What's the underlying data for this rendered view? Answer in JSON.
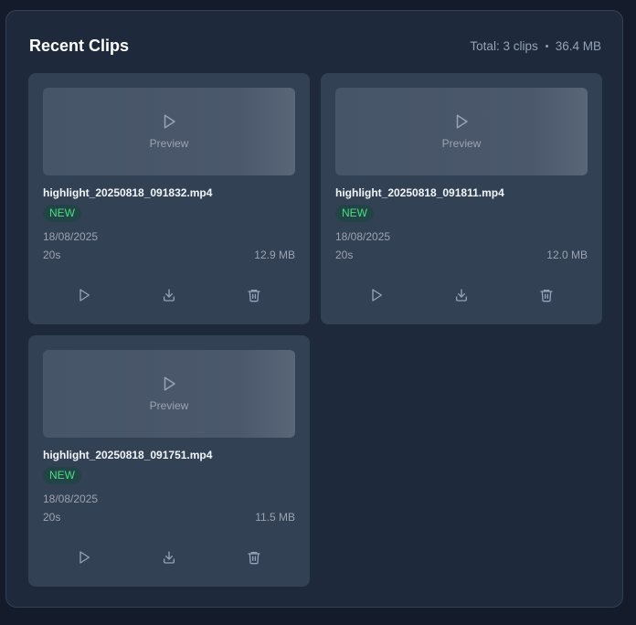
{
  "header": {
    "title": "Recent Clips",
    "total": "Total: 3 clips",
    "size": "36.4 MB"
  },
  "clips": [
    {
      "preview_label": "Preview",
      "filename": "highlight_20250818_091832.mp4",
      "badge": "NEW",
      "date": "18/08/2025",
      "duration": "20s",
      "size": "12.9 MB"
    },
    {
      "preview_label": "Preview",
      "filename": "highlight_20250818_091811.mp4",
      "badge": "NEW",
      "date": "18/08/2025",
      "duration": "20s",
      "size": "12.0 MB"
    },
    {
      "preview_label": "Preview",
      "filename": "highlight_20250818_091751.mp4",
      "badge": "NEW",
      "date": "18/08/2025",
      "duration": "20s",
      "size": "11.5 MB"
    }
  ],
  "icons": {
    "preview": "play-icon",
    "play": "play-icon",
    "download": "download-icon",
    "delete": "trash-icon"
  },
  "colors": {
    "background": "#141c2b",
    "panel": "#1e293b",
    "card": "#334155",
    "badge_text": "#4ade80",
    "muted_text": "#9ca3af"
  }
}
